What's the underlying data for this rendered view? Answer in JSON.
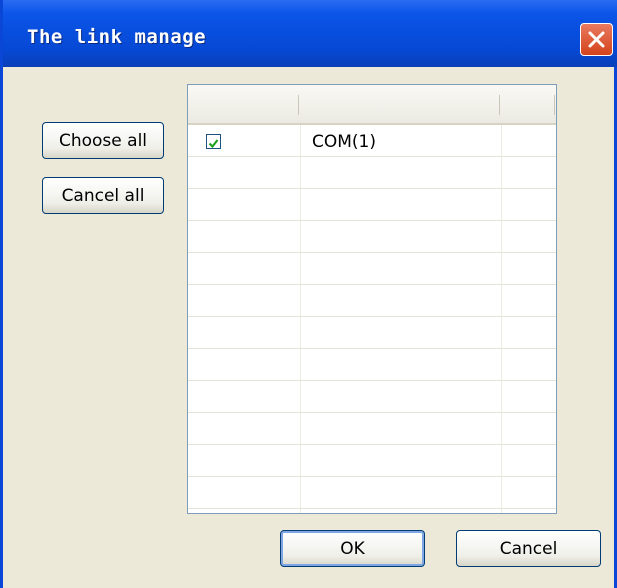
{
  "window": {
    "title": "The link manage"
  },
  "sidebar": {
    "choose_all_label": "Choose all",
    "cancel_all_label": "Cancel all"
  },
  "grid": {
    "columns": [
      "",
      "",
      ""
    ],
    "rows": [
      {
        "checked": true,
        "name": "COM(1)"
      }
    ]
  },
  "footer": {
    "ok_label": "OK",
    "cancel_label": "Cancel"
  },
  "colors": {
    "titlebar": "#0648d4",
    "close_button": "#d4431c",
    "check": "#21a121",
    "dialog_bg": "#ece9d8"
  }
}
